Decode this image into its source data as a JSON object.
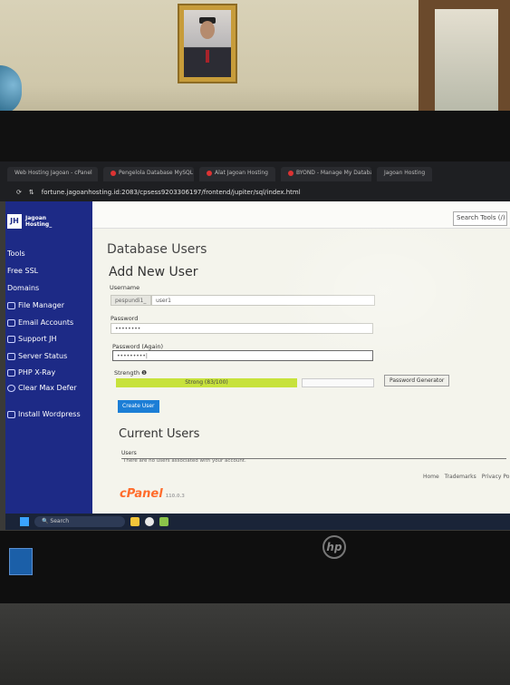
{
  "browser": {
    "tabs": [
      "Web Hosting Jagoan - cPanel",
      "Pengelola Database MySQL",
      "Alat Jagoan Hosting",
      "BYOND - Manage My Databases",
      "Jagoan Hosting"
    ],
    "url": "fortune.jagoanhosting.id:2083/cpsess9203306197/frontend/jupiter/sql/index.html"
  },
  "brand": {
    "mark": "JH",
    "name": "Jagoan Hosting_"
  },
  "sidebar": {
    "items": [
      {
        "label": "Tools",
        "icon": "none"
      },
      {
        "label": "Free SSL",
        "icon": "lock-icon"
      },
      {
        "label": "Domains",
        "icon": "globe-icon"
      },
      {
        "label": "File Manager",
        "icon": "folder-icon"
      },
      {
        "label": "Email Accounts",
        "icon": "mail-icon"
      },
      {
        "label": "Support JH",
        "icon": "user-icon"
      },
      {
        "label": "Server Status",
        "icon": "server-icon"
      },
      {
        "label": "PHP X-Ray",
        "icon": "php-icon"
      },
      {
        "label": "Clear Max Defer",
        "icon": "clear-icon"
      },
      {
        "label": "Install Wordpress",
        "icon": "wordpress-icon"
      }
    ]
  },
  "header": {
    "search_tools": "Search Tools (/)"
  },
  "main": {
    "title": "Database Users",
    "add_user_heading": "Add New User",
    "username_label": "Username",
    "username_prefix": "pespundi1_",
    "username_value": "user1",
    "password_label": "Password",
    "password_value": "••••••••",
    "password_again_label": "Password (Again)",
    "password_again_value": "•••••••••|",
    "strength_label": "Strength ❶",
    "strength_text": "Strong (83/100)",
    "strength_percent": 83,
    "password_generator": "Password Generator",
    "create_user": "Create User",
    "current_users_heading": "Current Users",
    "users_column": "Users",
    "empty_message": "There are no users associated with your account."
  },
  "footer": {
    "links": [
      "Home",
      "Trademarks",
      "Privacy Po"
    ]
  },
  "cpanel": {
    "logo": "cPanel",
    "version": "110.0.3"
  },
  "taskbar": {
    "search_placeholder": "Search"
  },
  "colors": {
    "sidebar": "#1d2a86",
    "meter": "#c7e23c",
    "button": "#1c7ed6",
    "cpanel_orange": "#ff6c2c"
  }
}
